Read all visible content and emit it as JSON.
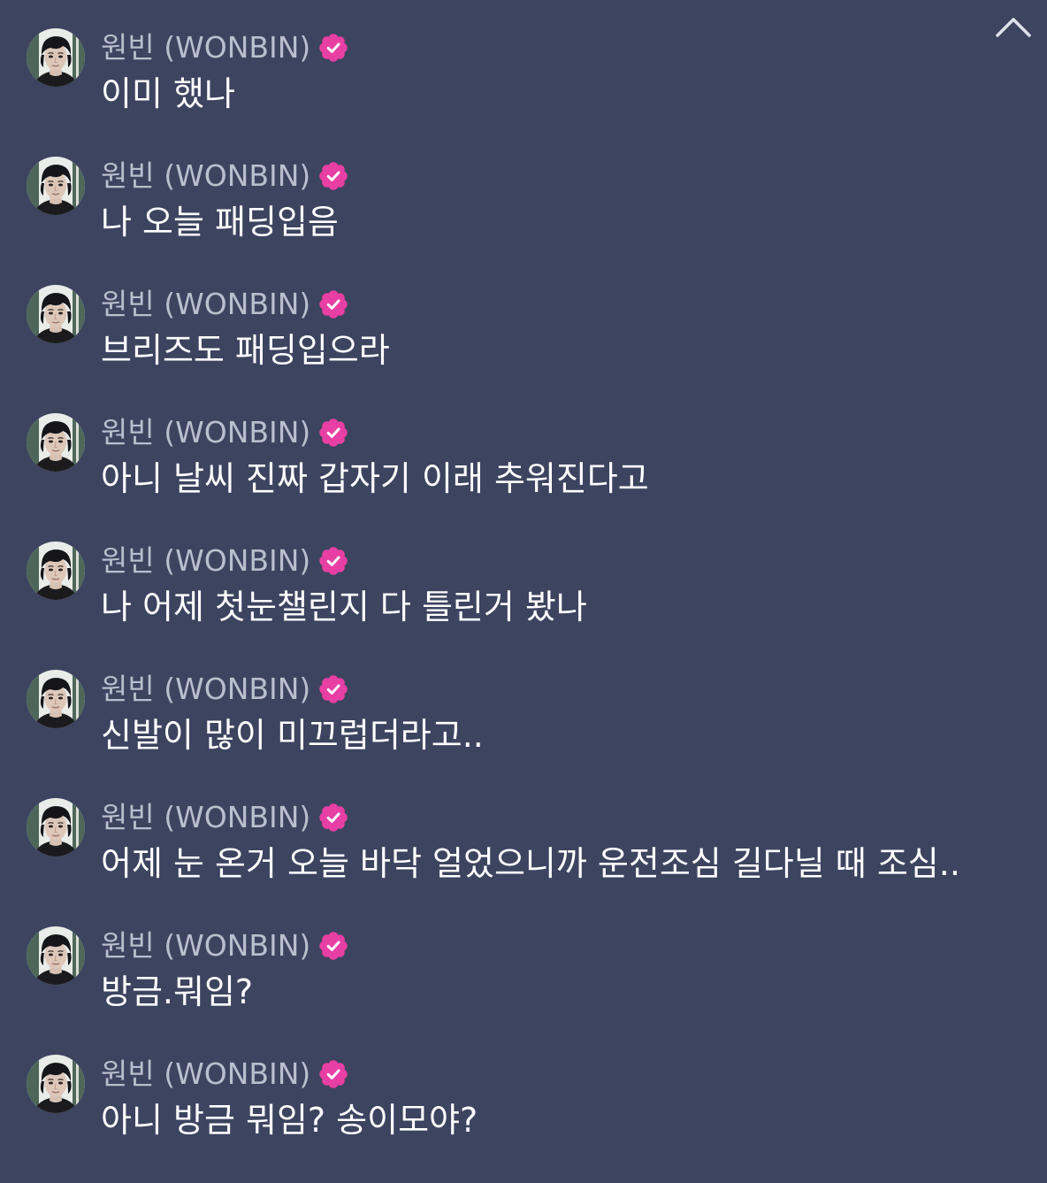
{
  "colors": {
    "background": "#3d4460",
    "sender_name": "#b9bfce",
    "message_text": "#ffffff",
    "verified_badge": "#e83fa4"
  },
  "icons": {
    "collapse": "chevron-up-icon",
    "verified": "verified-badge-icon"
  },
  "messages": [
    {
      "sender": "원빈 (WONBIN)",
      "text": "이미 했나"
    },
    {
      "sender": "원빈 (WONBIN)",
      "text": "나 오늘 패딩입음"
    },
    {
      "sender": "원빈 (WONBIN)",
      "text": "브리즈도 패딩입으라"
    },
    {
      "sender": "원빈 (WONBIN)",
      "text": "아니 날씨 진짜 갑자기 이래 추워진다고"
    },
    {
      "sender": "원빈 (WONBIN)",
      "text": "나 어제 첫눈챌린지 다 틀린거 봤나"
    },
    {
      "sender": "원빈 (WONBIN)",
      "text": "신발이 많이 미끄럽더라고.."
    },
    {
      "sender": "원빈 (WONBIN)",
      "text": "어제 눈 온거 오늘 바닥 얼었으니까 운전조심 길다닐 때 조심.."
    },
    {
      "sender": "원빈 (WONBIN)",
      "text": "방금.뭐임?"
    },
    {
      "sender": "원빈 (WONBIN)",
      "text": "아니 방금 뭐임? 송이모야?"
    }
  ]
}
